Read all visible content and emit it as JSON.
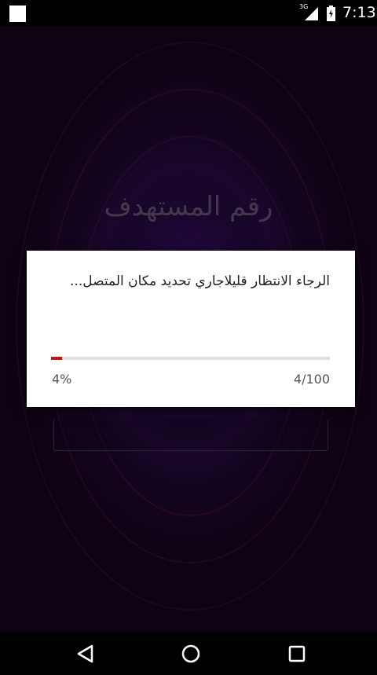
{
  "status_bar": {
    "network_type": "3G",
    "time": "7:13",
    "icons": [
      "notification-square-icon",
      "signal-icon",
      "battery-icon"
    ]
  },
  "app": {
    "title": "رقم المستهدف"
  },
  "dialog": {
    "message": "الرجاء الانتظار قليلاجاري تحديد مكان المتصل...",
    "progress_percent_label": "4%",
    "progress_count_label": "4/100",
    "progress_value": 4,
    "progress_max": 100,
    "accent_color": "#b71c1c"
  },
  "nav_bar": {
    "icons": [
      "back-icon",
      "home-icon",
      "recents-icon"
    ]
  }
}
